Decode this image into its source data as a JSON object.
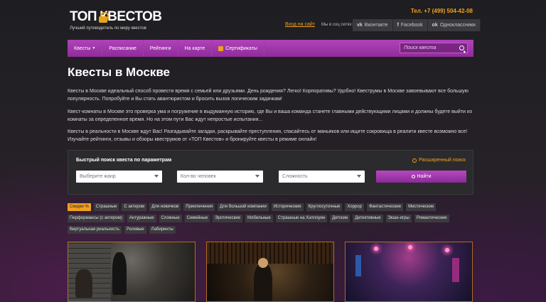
{
  "header": {
    "logo_text": "ТОП КВЕСТОВ",
    "logo_left": "ТОП",
    "logo_right": "КВЕСТОВ",
    "tagline": "Лучший путеводитель по миру квестов",
    "phone": "Тел. +7 (499) 504-42-08",
    "login": "Вход на сайт",
    "social_label": "Мы в соц сетях:",
    "socials": [
      {
        "icon": "vk-icon",
        "label": "Вконтакте"
      },
      {
        "icon": "facebook-icon",
        "label": "Facebook"
      },
      {
        "icon": "odnoklassniki-icon",
        "label": "Одноклассники"
      }
    ]
  },
  "nav": {
    "items": [
      {
        "label": "Квесты"
      },
      {
        "label": "Расписание"
      },
      {
        "label": "Рейтинги"
      },
      {
        "label": "На карте"
      },
      {
        "label": "Сертификаты"
      }
    ],
    "search_placeholder": "Поиск квеста"
  },
  "page": {
    "title": "Квесты в Москве",
    "p1": "Квесты в Москве идеальный способ провести время с семьей или друзьями. День рождения? Легко! Корпоративы? Удобно! Квеструмы в Москве завоевывают все большую популярность. Попробуйте и Вы стать авантюристом и бросить вызов логическим задачкам!",
    "p2": "Квест-комнаты в Москве это проверка ума и погружение в выдуманную историю, где Вы и ваша команда станете главными действующими лицами и должны будете выйти из комнаты за определенное время.  Но на этом пути Вас ждут непростые испытания...",
    "p3": "Квесты в реальности в Москве ждут Вас! Разгадывайте загадки, раскрывайте преступления, спасайтесь от маньяков или ищите сокровища в реалити квесте возможно все! Изучайте рейтинги, отзывы и обзоры квеструмов от «ТОП Квестов» и бронируйте квесты в режиме онлайн!"
  },
  "quick_search": {
    "title": "Быстрый поиск квеста по параметрам",
    "advanced": "Расширенный поиск",
    "genre": "Выберите жанр",
    "people": "Кол-во человек",
    "difficulty": "Сложность",
    "button": "Найти"
  },
  "tags": [
    "Скидки %",
    "Страшные",
    "С актером",
    "Для новичков",
    "Приключения",
    "Для большой компании",
    "Исторические",
    "Круглосуточные",
    "Хоррор",
    "Фантастические",
    "Мистические",
    "Перформансы (с актером)",
    "Антуражные",
    "Сложные",
    "Семейные",
    "Эротические",
    "Мобильные",
    "Страшные на Хэллоуин",
    "Детские",
    "Детективные",
    "Экшн-игры",
    "Романтические",
    "Виртуальная реальность",
    "Ролевые",
    "Лабиринты"
  ],
  "colors": {
    "accent": "#f2a21c",
    "nav": "#a33aad",
    "background": "#1e1e22"
  }
}
